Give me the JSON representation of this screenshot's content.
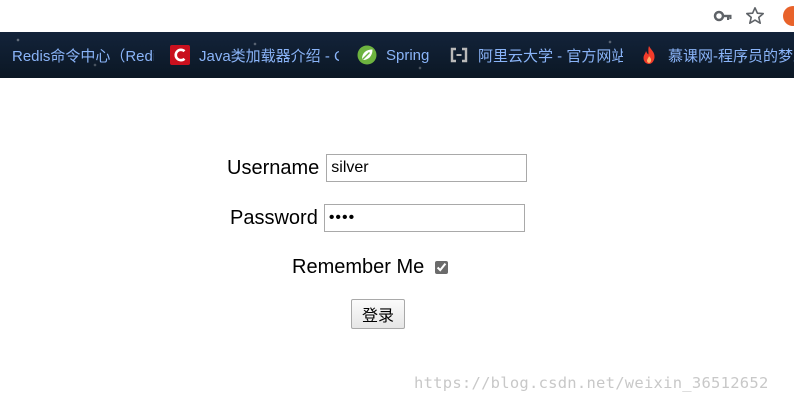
{
  "browser": {
    "bookmarks": [
      {
        "label": "Redis命令中心（Redis commands）",
        "icon": "redis-icon"
      },
      {
        "label": "Java类加载器介绍 - CSDN博客",
        "icon": "csdn-icon"
      },
      {
        "label": "Spring",
        "icon": "spring-leaf-icon"
      },
      {
        "label": "阿里云大学 - 官方网站",
        "icon": "aliyun-icon"
      },
      {
        "label": "慕课网-程序员的梦工厂",
        "icon": "imooc-flame-icon"
      }
    ],
    "toolbar_icons": [
      "key-icon",
      "star-icon",
      "extension-icon"
    ]
  },
  "form": {
    "username_label": "Username",
    "username_value": "silver",
    "password_label": "Password",
    "password_value": "••••",
    "remember_label": "Remember Me",
    "remember_checked": true,
    "submit_label": "登录"
  },
  "watermark": "https://blog.csdn.net/weixin_36512652",
  "colors": {
    "bookmark_text": "#8ab4f8",
    "bookmark_bar_bg": "#0f1c2c",
    "csdn_red": "#c9101e",
    "spring_green": "#6db33f",
    "flame": "#f23b2a"
  }
}
